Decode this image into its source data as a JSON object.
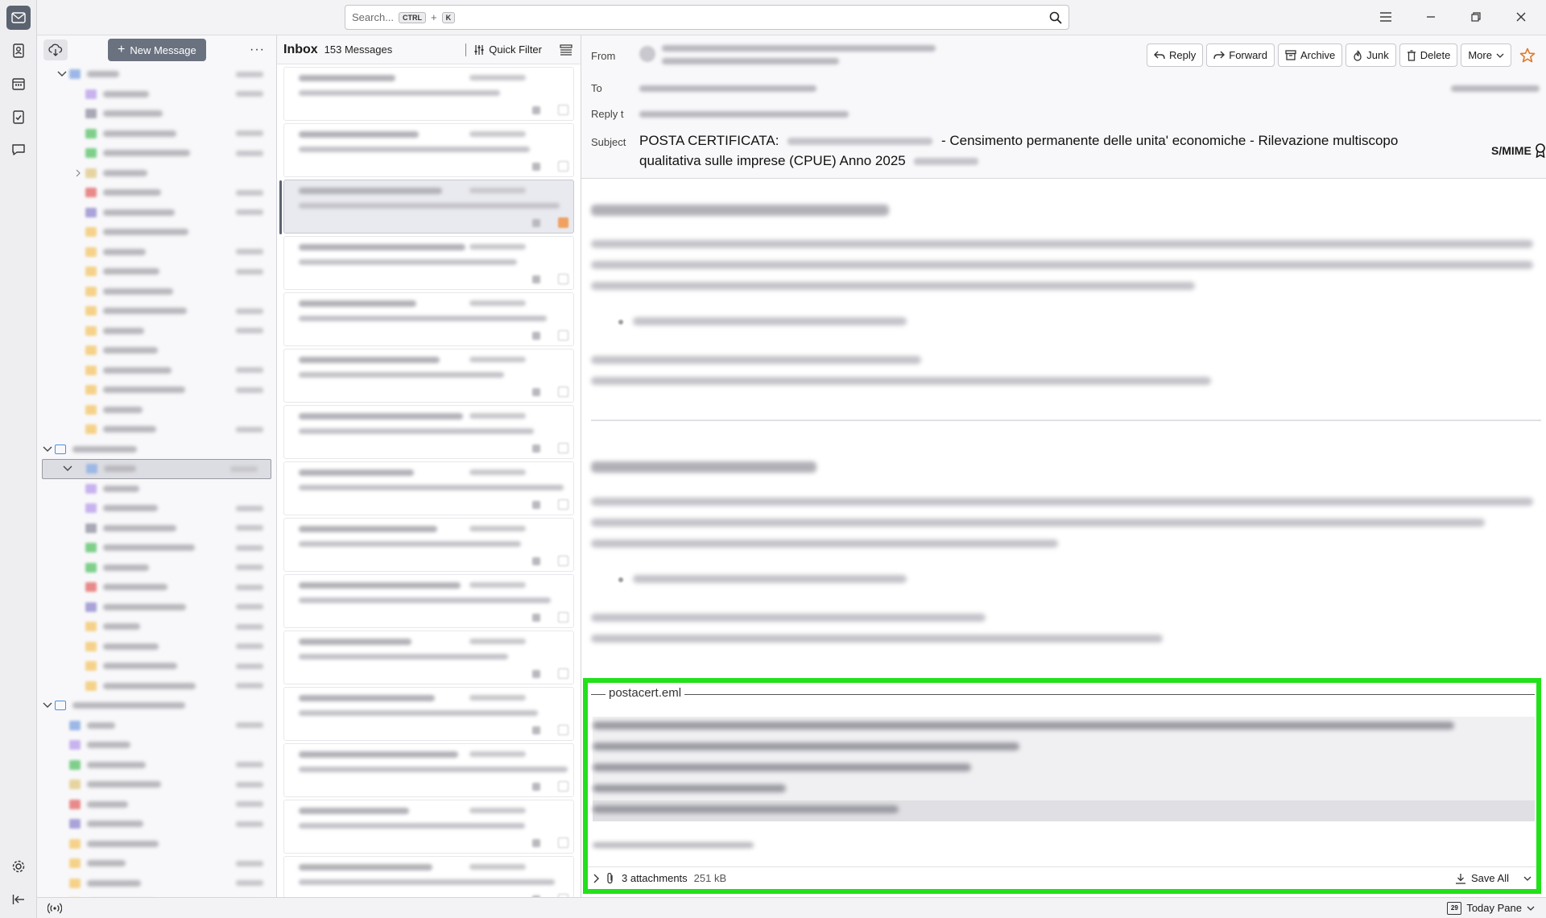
{
  "search": {
    "placeholder": "Search...",
    "key_ctrl": "CTRL",
    "key_plus": "+",
    "key_k": "K"
  },
  "folder_pane": {
    "new_message_label": "New Message",
    "more_label": "···"
  },
  "message_list": {
    "folder_name": "Inbox",
    "count_label": "153 Messages",
    "quick_filter_label": "Quick Filter"
  },
  "header": {
    "from_label": "From",
    "to_label": "To",
    "reply_to_label": "Reply t",
    "subject_label": "Subject",
    "buttons": {
      "reply": "Reply",
      "forward": "Forward",
      "archive": "Archive",
      "junk": "Junk",
      "delete": "Delete",
      "more": "More"
    },
    "subject_prefix": "POSTA CERTIFICATA:",
    "subject_main": "- Censimento permanente delle unita' economiche - Rilevazione multiscopo qualitativa sulle imprese (CPUE) Anno 2025",
    "smime_label": "S/MIME"
  },
  "attachment": {
    "legend": "postacert.eml",
    "count_label": "3 attachments",
    "size_label": "251 kB",
    "save_all_label": "Save All"
  },
  "status": {
    "today_pane_label": "Today Pane",
    "calendar_day": "29"
  },
  "colors": {
    "accent": "#5b6370",
    "highlight_border": "#22e11a",
    "star": "#e07a26"
  }
}
